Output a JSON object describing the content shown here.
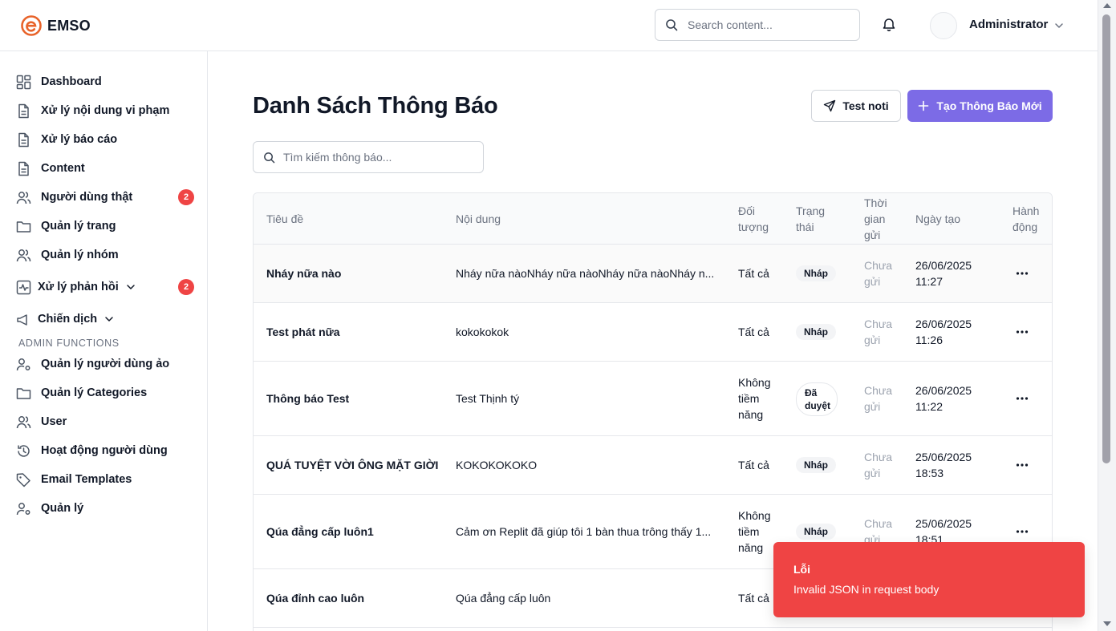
{
  "app": {
    "name": "EMSO",
    "brand_color": "#e8632a"
  },
  "header": {
    "search_placeholder": "Search content...",
    "user_name": "Administrator"
  },
  "sidebar": {
    "items": [
      {
        "label": "Dashboard",
        "icon": "dashboard-icon"
      },
      {
        "label": "Xử lý nội dung vi phạm",
        "icon": "document-icon"
      },
      {
        "label": "Xử lý báo cáo",
        "icon": "document-icon"
      },
      {
        "label": "Content",
        "icon": "document-icon"
      },
      {
        "label": "Người dùng thật",
        "icon": "users-icon",
        "badge": "2"
      },
      {
        "label": "Quản lý trang",
        "icon": "folder-icon"
      },
      {
        "label": "Quản lý nhóm",
        "icon": "users-icon"
      },
      {
        "label": "Xử lý phản hồi",
        "icon": "activity-icon",
        "badge": "2"
      },
      {
        "label": "Chiến dịch",
        "icon": "megaphone-icon"
      }
    ],
    "section_title": "ADMIN FUNCTIONS",
    "admin_items": [
      {
        "label": "Quản lý người dùng ảo",
        "icon": "user-cog-icon"
      },
      {
        "label": "Quản lý Categories",
        "icon": "folder-icon"
      },
      {
        "label": "User",
        "icon": "users-icon"
      },
      {
        "label": "Hoạt động người dùng",
        "icon": "history-icon"
      },
      {
        "label": "Email Templates",
        "icon": "tag-icon"
      },
      {
        "label": "Quản lý",
        "icon": "user-cog-icon"
      }
    ]
  },
  "main": {
    "title": "Danh Sách Thông Báo",
    "test_button": "Test noti",
    "create_button": "Tạo Thông Báo Mới",
    "create_button_color": "#7c6be6",
    "search_placeholder": "Tìm kiếm thông báo..."
  },
  "table": {
    "headers": {
      "title": "Tiêu đề",
      "content": "Nội dung",
      "target_1": "Đối",
      "target_2": "tượng",
      "status_1": "Trạng",
      "status_2": "thái",
      "send_1": "Thời",
      "send_2": "gian",
      "send_3": "gửi",
      "created": "Ngày tạo",
      "action_1": "Hành",
      "action_2": "động"
    },
    "rows": [
      {
        "title": "Nháy nữa nào",
        "content": "Nháy nữa nàoNháy nữa nàoNháy nữa nàoNháy n...",
        "target_1": "Tất cả",
        "target_2": "",
        "target_3": "",
        "status_1": "Nháp",
        "status_2": "",
        "send_1": "Chưa",
        "send_2": "gửi",
        "date": "26/06/2025",
        "time": "11:27"
      },
      {
        "title": "Test phát nữa",
        "content": "kokokokok",
        "target_1": "Tất cả",
        "target_2": "",
        "target_3": "",
        "status_1": "Nháp",
        "status_2": "",
        "send_1": "Chưa",
        "send_2": "gửi",
        "date": "26/06/2025",
        "time": "11:26"
      },
      {
        "title": "Thông báo Test",
        "content": "Test Thịnh tý",
        "target_1": "Không",
        "target_2": "tiềm",
        "target_3": "năng",
        "status_1": "Đã",
        "status_2": "duyệt",
        "send_1": "Chưa",
        "send_2": "gửi",
        "date": "26/06/2025",
        "time": "11:22"
      },
      {
        "title": "QUÁ TUYỆT VỜI ÔNG MẶT GIỜI",
        "content": "KOKOKOKOKO",
        "target_1": "Tất cả",
        "target_2": "",
        "target_3": "",
        "status_1": "Nháp",
        "status_2": "",
        "send_1": "Chưa",
        "send_2": "gửi",
        "date": "25/06/2025",
        "time": "18:53"
      },
      {
        "title": "Qúa đẳng cấp luôn1",
        "content": "Cảm ơn Replit đã giúp tôi 1 bàn thua trông thấy 1...",
        "target_1": "Không",
        "target_2": "tiềm",
        "target_3": "năng",
        "status_1": "Nháp",
        "status_2": "",
        "send_1": "Chưa",
        "send_2": "gửi",
        "date": "25/06/2025",
        "time": "18:51"
      },
      {
        "title": "Qúa đỉnh cao luôn",
        "content": "Qúa đẳng cấp luôn",
        "target_1": "Tất cả",
        "target_2": "",
        "target_3": "",
        "status_1": "",
        "status_2": "",
        "send_1": "",
        "send_2": "",
        "date": "",
        "time": ""
      }
    ]
  },
  "toast": {
    "title": "Lỗi",
    "message": "Invalid JSON in request body",
    "color": "#ef4444"
  }
}
